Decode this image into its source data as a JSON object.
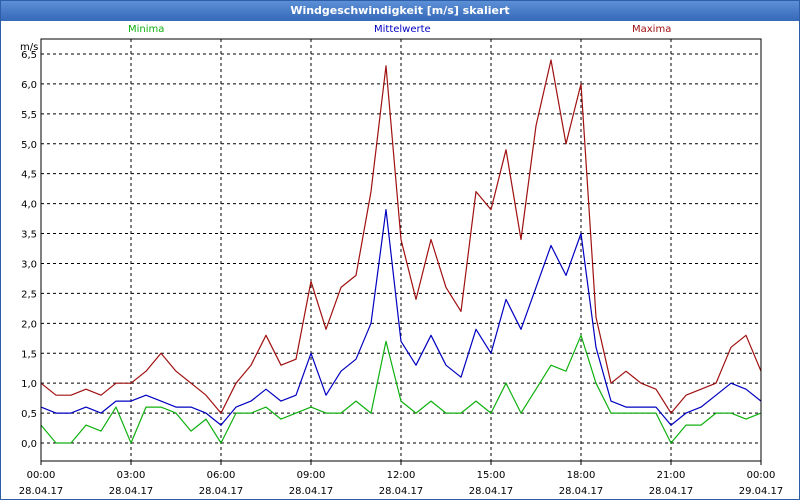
{
  "window": {
    "title": "Windgeschwindigkeit [m/s] skaliert"
  },
  "legend": {
    "minima": "Minima",
    "mittel": "Mittelwerte",
    "maxima": "Maxima"
  },
  "colors": {
    "minima": "#10b010",
    "mittel": "#0000c0",
    "maxima": "#a01010"
  },
  "chart_data": {
    "type": "line",
    "title": "Windgeschwindigkeit [m/s] skaliert",
    "ylabel": "m/s",
    "xlabel": "",
    "ylim": [
      -0.3,
      6.75
    ],
    "xlim_hours": [
      0,
      24
    ],
    "grid": true,
    "legend_position": "top",
    "y_ticks": [
      "0,0",
      "0,5",
      "1,0",
      "1,5",
      "2,0",
      "2,5",
      "3,0",
      "3,5",
      "4,0",
      "4,5",
      "5,0",
      "5,5",
      "6,0",
      "6,5"
    ],
    "x_ticks": [
      {
        "time": "00:00",
        "date": "28.04.17"
      },
      {
        "time": "03:00",
        "date": "28.04.17"
      },
      {
        "time": "06:00",
        "date": "28.04.17"
      },
      {
        "time": "09:00",
        "date": "28.04.17"
      },
      {
        "time": "12:00",
        "date": "28.04.17"
      },
      {
        "time": "15:00",
        "date": "28.04.17"
      },
      {
        "time": "18:00",
        "date": "28.04.17"
      },
      {
        "time": "21:00",
        "date": "28.04.17"
      },
      {
        "time": "00:00",
        "date": "29.04.17"
      }
    ],
    "x_hours": [
      0,
      0.5,
      1,
      1.5,
      2,
      2.5,
      3,
      3.5,
      4,
      4.5,
      5,
      5.5,
      6,
      6.5,
      7,
      7.5,
      8,
      8.5,
      9,
      9.5,
      10,
      10.5,
      11,
      11.5,
      12,
      12.5,
      13,
      13.5,
      14,
      14.5,
      15,
      15.5,
      16,
      16.5,
      17,
      17.5,
      18,
      18.5,
      19,
      19.5,
      20,
      20.5,
      21,
      21.5,
      22,
      22.5,
      23,
      23.5,
      24
    ],
    "series": [
      {
        "name": "Maxima",
        "key": "maxima",
        "values": [
          1.0,
          0.8,
          0.8,
          0.9,
          0.8,
          1.0,
          1.0,
          1.2,
          1.5,
          1.2,
          1.0,
          0.8,
          0.5,
          1.0,
          1.3,
          1.8,
          1.3,
          1.4,
          2.7,
          1.9,
          2.6,
          2.8,
          4.2,
          6.3,
          3.4,
          2.4,
          3.4,
          2.6,
          2.2,
          4.2,
          3.9,
          4.9,
          3.4,
          5.3,
          6.4,
          5.0,
          6.0,
          2.1,
          1.0,
          1.2,
          1.0,
          0.9,
          0.5,
          0.8,
          0.9,
          1.0,
          1.6,
          1.8,
          1.2
        ]
      },
      {
        "name": "Mittelwerte",
        "key": "mittel",
        "values": [
          0.6,
          0.5,
          0.5,
          0.6,
          0.5,
          0.7,
          0.7,
          0.8,
          0.7,
          0.6,
          0.6,
          0.5,
          0.3,
          0.6,
          0.7,
          0.9,
          0.7,
          0.8,
          1.5,
          0.8,
          1.2,
          1.4,
          2.0,
          3.9,
          1.7,
          1.3,
          1.8,
          1.3,
          1.1,
          1.9,
          1.5,
          2.4,
          1.9,
          2.6,
          3.3,
          2.8,
          3.5,
          1.6,
          0.7,
          0.6,
          0.6,
          0.6,
          0.3,
          0.5,
          0.6,
          0.8,
          1.0,
          0.9,
          0.7
        ]
      },
      {
        "name": "Minima",
        "key": "minima",
        "values": [
          0.3,
          0.0,
          0.0,
          0.3,
          0.2,
          0.6,
          0.0,
          0.6,
          0.6,
          0.5,
          0.2,
          0.4,
          0.0,
          0.5,
          0.5,
          0.6,
          0.4,
          0.5,
          0.6,
          0.5,
          0.5,
          0.7,
          0.5,
          1.7,
          0.7,
          0.5,
          0.7,
          0.5,
          0.5,
          0.7,
          0.5,
          1.0,
          0.5,
          0.9,
          1.3,
          1.2,
          1.8,
          1.0,
          0.5,
          0.5,
          0.5,
          0.5,
          0.0,
          0.3,
          0.3,
          0.5,
          0.5,
          0.4,
          0.5
        ]
      }
    ]
  }
}
